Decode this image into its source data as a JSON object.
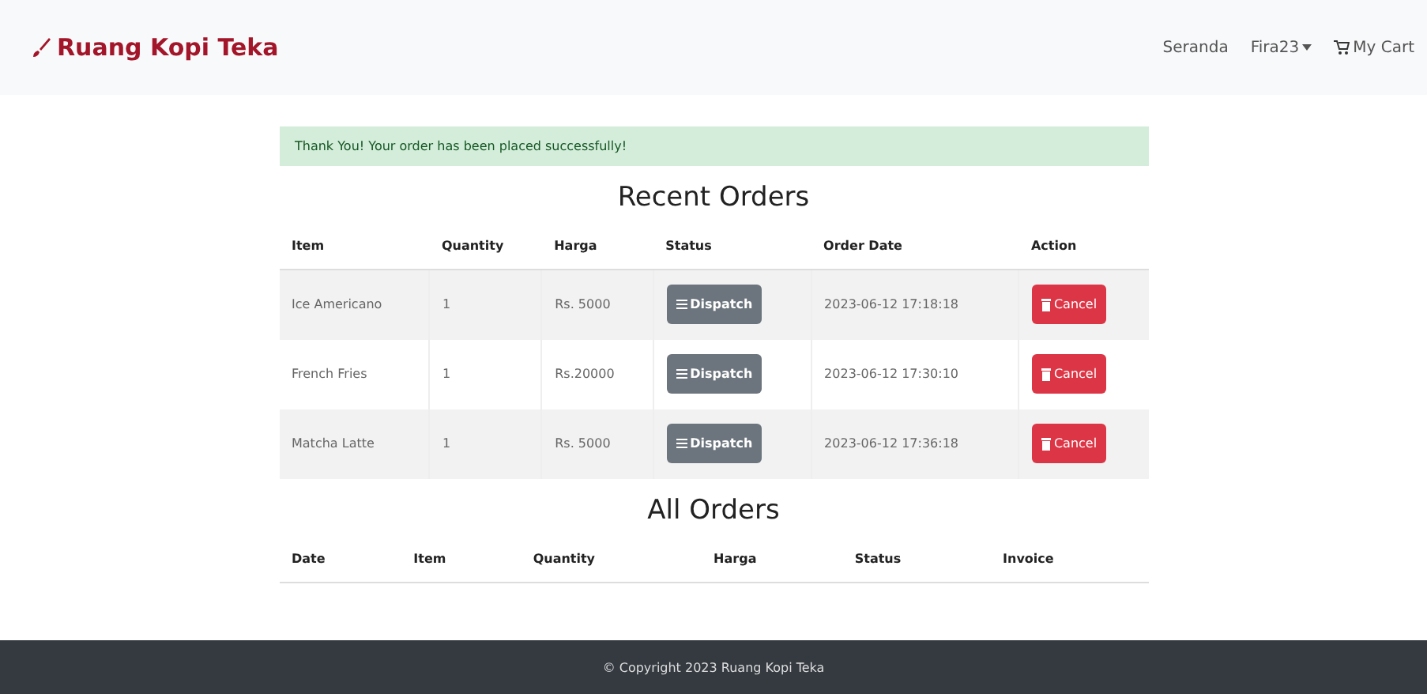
{
  "navbar": {
    "brand": "Ruang Kopi Teka",
    "links": [
      {
        "label": "Seranda",
        "kind": "link"
      },
      {
        "label": "Fira23",
        "kind": "dropdown"
      },
      {
        "label": "My Cart",
        "kind": "cart"
      }
    ]
  },
  "alert": "Thank You! Your order has been placed successfully!",
  "recent_orders": {
    "title": "Recent Orders",
    "columns": [
      "Item",
      "Quantity",
      "Harga",
      "Status",
      "Order Date",
      "Action"
    ],
    "rows": [
      {
        "item": "Ice Americano",
        "quantity": "1",
        "harga": "Rs. 5000",
        "status": "Dispatch",
        "date": "2023-06-12 17:18:18",
        "action": "Cancel"
      },
      {
        "item": "French Fries",
        "quantity": "1",
        "harga": "Rs.20000",
        "status": "Dispatch",
        "date": "2023-06-12 17:30:10",
        "action": "Cancel"
      },
      {
        "item": "Matcha Latte",
        "quantity": "1",
        "harga": "Rs. 5000",
        "status": "Dispatch",
        "date": "2023-06-12 17:36:18",
        "action": "Cancel"
      }
    ]
  },
  "all_orders": {
    "title": "All Orders",
    "columns": [
      "Date",
      "Item",
      "Quantity",
      "Harga",
      "Status",
      "Invoice"
    ]
  },
  "footer": "© Copyright 2023 Ruang Kopi Teka"
}
